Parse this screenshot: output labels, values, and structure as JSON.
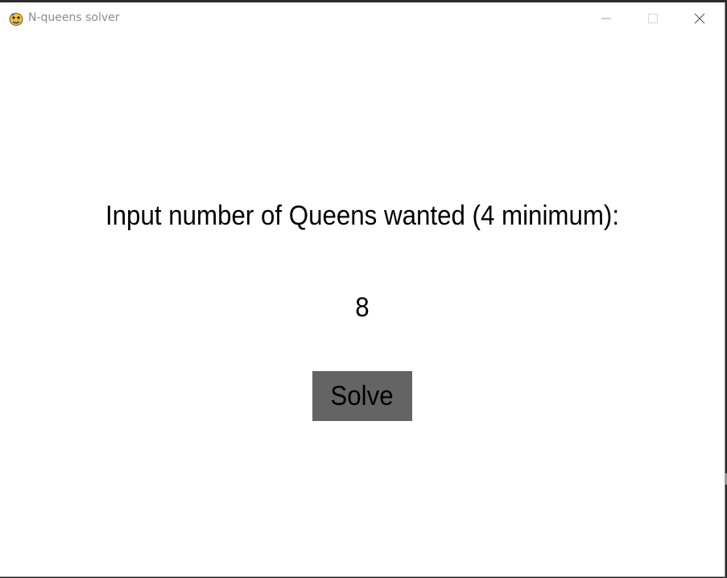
{
  "window": {
    "title": "N-queens solver"
  },
  "controls": {
    "minimize_icon": "minimize-icon",
    "maximize_icon": "maximize-icon",
    "close_icon": "close-icon"
  },
  "main": {
    "prompt": "Input number of Queens wanted (4 minimum):",
    "queen_count": "8",
    "solve_label": "Solve"
  },
  "colors": {
    "button_bg": "#646464",
    "background": "#ffffff",
    "text": "#000000",
    "title_text": "#8c8c8c"
  }
}
